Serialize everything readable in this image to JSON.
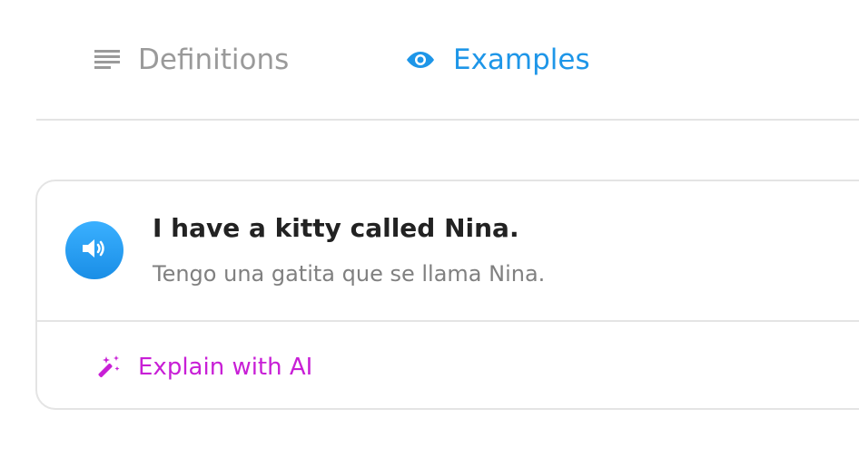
{
  "tabs": {
    "definitions": {
      "label": "Definitions",
      "icon": "lines-icon"
    },
    "examples": {
      "label": "Examples",
      "icon": "eye-icon",
      "active": true
    }
  },
  "example": {
    "sentence": "I have a kitty called Nina.",
    "translation": "Tengo una gatita que se llama Nina.",
    "audio_icon": "speaker-icon"
  },
  "ai": {
    "label": "Explain with AI",
    "icon": "magic-wand-icon"
  },
  "colors": {
    "active_tab": "#1e96e8",
    "inactive_tab": "#9a9a9a",
    "ai_accent": "#c81fd6"
  }
}
